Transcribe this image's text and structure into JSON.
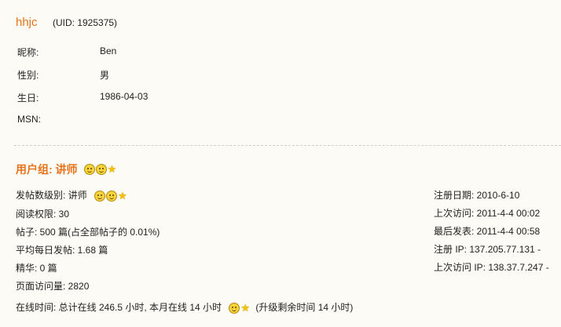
{
  "profile": {
    "username": "hhjc",
    "uid_text": "(UID: 1925375)",
    "fields": [
      {
        "label": "昵称:",
        "value": "Ben"
      },
      {
        "label": "性别:",
        "value": "男"
      },
      {
        "label": "生日:",
        "value": "1986-04-03"
      },
      {
        "label": "MSN:",
        "value": ""
      }
    ]
  },
  "group": {
    "title": "用户组: 讲师",
    "icons": [
      "smiley-icon",
      "smiley-icon",
      "star-icon"
    ]
  },
  "stats_left": {
    "post_level": "发帖数级别: 讲师",
    "read_permission": "阅读权限: 30",
    "posts": "帖子: 500 篇(占全部帖子的  0.01%)",
    "daily_posts": "平均每日发帖: 1.68 篇",
    "digest": "精华: 0 篇",
    "page_views": "页面访问量: 2820",
    "online_time_prefix": "在线时间: 总计在线  246.5 小时, 本月在线  14 小时",
    "online_time_suffix": "(升级剩余时间  14 小时)"
  },
  "stats_right": {
    "register_date": "注册日期: 2010-6-10",
    "last_visit": "上次访问: 2011-4-4 00:02",
    "last_post": "最后发表: 2011-4-4 00:58",
    "register_ip": "注册  IP: 137.205.77.131 -",
    "last_visit_ip": "上次访问  IP: 138.37.7.247 -"
  },
  "colors": {
    "accent": "#e8731c",
    "background": "#fdfbf6",
    "text": "#222222"
  }
}
